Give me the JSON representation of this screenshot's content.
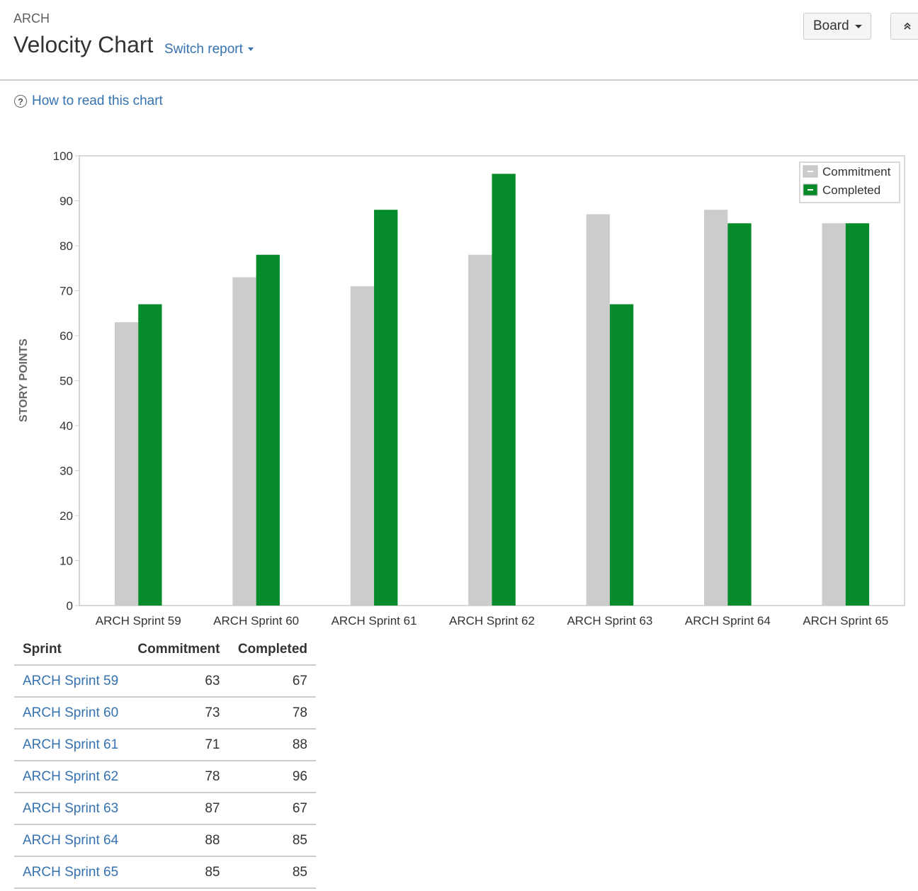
{
  "header": {
    "project": "ARCH",
    "title": "Velocity Chart",
    "switch_report": "Switch report",
    "board_button": "Board",
    "collapse_icon": "double-chevron-up-icon"
  },
  "help": {
    "label": "How to read this chart",
    "icon": "question-circle-icon"
  },
  "colors": {
    "commitment": "#cccccc",
    "completed": "#058a2c",
    "link": "#3572b0"
  },
  "chart_data": {
    "type": "bar",
    "title": "",
    "xlabel": "",
    "ylabel": "STORY POINTS",
    "ylim": [
      0,
      100
    ],
    "yticks": [
      0,
      10,
      20,
      30,
      40,
      50,
      60,
      70,
      80,
      90,
      100
    ],
    "grid": false,
    "legend_position": "top-right",
    "categories": [
      "ARCH Sprint 59",
      "ARCH Sprint 60",
      "ARCH Sprint 61",
      "ARCH Sprint 62",
      "ARCH Sprint 63",
      "ARCH Sprint 64",
      "ARCH Sprint 65"
    ],
    "series": [
      {
        "name": "Commitment",
        "values": [
          63,
          73,
          71,
          78,
          87,
          88,
          85
        ]
      },
      {
        "name": "Completed",
        "values": [
          67,
          78,
          88,
          96,
          67,
          85,
          85
        ]
      }
    ]
  },
  "table": {
    "headers": [
      "Sprint",
      "Commitment",
      "Completed"
    ],
    "rows": [
      [
        "ARCH Sprint 59",
        "63",
        "67"
      ],
      [
        "ARCH Sprint 60",
        "73",
        "78"
      ],
      [
        "ARCH Sprint 61",
        "71",
        "88"
      ],
      [
        "ARCH Sprint 62",
        "78",
        "96"
      ],
      [
        "ARCH Sprint 63",
        "87",
        "67"
      ],
      [
        "ARCH Sprint 64",
        "88",
        "85"
      ],
      [
        "ARCH Sprint 65",
        "85",
        "85"
      ]
    ]
  }
}
